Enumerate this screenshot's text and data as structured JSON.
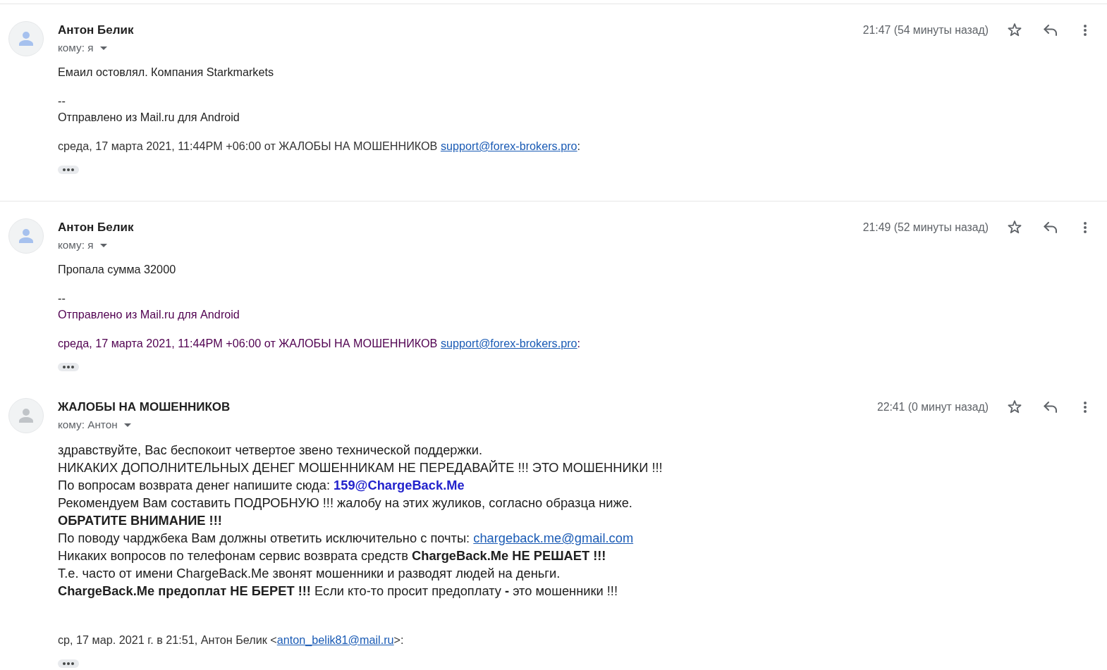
{
  "messages": [
    {
      "sender": "Антон Белик",
      "avatar": {
        "color": "#a6c1ee"
      },
      "recipient": "кому: я",
      "time": "21:47 (54 минуты назад)",
      "starred": false,
      "kind": "plain",
      "body": [
        {
          "lines": [
            {
              "quoted": false,
              "parts": [
                {
                  "kind": "text",
                  "text": "Емаил остовлял. Компания Starkmarkets"
                }
              ]
            }
          ]
        },
        {
          "lines": [
            {
              "quoted": false,
              "parts": [
                {
                  "kind": "text",
                  "text": "--"
                }
              ]
            },
            {
              "quoted": false,
              "parts": [
                {
                  "kind": "text",
                  "text": "Отправлено из Mail.ru для Android"
                }
              ]
            }
          ]
        }
      ],
      "quote_header": {
        "quoted": false,
        "parts": [
          {
            "kind": "text",
            "text": "среда, 17 марта 2021, 11:44PM +06:00 от ЖАЛОБЫ НА МОШЕННИКОВ "
          },
          {
            "kind": "link",
            "text": "support@forex-brokers.pro"
          },
          {
            "kind": "text",
            "text": ":"
          }
        ]
      }
    },
    {
      "sender": "Антон Белик",
      "avatar": {
        "color": "#a6c1ee"
      },
      "recipient": "кому: я",
      "time": "21:49 (52 минуты назад)",
      "starred": false,
      "kind": "plain",
      "body": [
        {
          "lines": [
            {
              "quoted": false,
              "parts": [
                {
                  "kind": "text",
                  "text": "Пропала сумма 32000"
                }
              ]
            }
          ]
        },
        {
          "lines": [
            {
              "quoted": false,
              "parts": [
                {
                  "kind": "text",
                  "text": "--"
                }
              ]
            },
            {
              "quoted": true,
              "parts": [
                {
                  "kind": "text",
                  "text": "Отправлено из Mail.ru для Android"
                }
              ]
            }
          ]
        }
      ],
      "quote_header": {
        "quoted": true,
        "parts": [
          {
            "kind": "text",
            "text": "среда, 17 марта 2021, 11:44PM +06:00 от ЖАЛОБЫ НА МОШЕННИКОВ "
          },
          {
            "kind": "link",
            "text": "support@forex-brokers.pro"
          },
          {
            "kind": "text",
            "text": ":"
          }
        ]
      }
    },
    {
      "sender": "ЖАЛОБЫ НА МОШЕННИКОВ",
      "avatar": {
        "color": "#c0c4c8"
      },
      "recipient": "кому: Антон",
      "time": "22:41 (0 минут назад)",
      "starred": false,
      "kind": "html",
      "body": [
        {
          "lines": [
            {
              "quoted": false,
              "parts": [
                {
                  "kind": "text",
                  "text": "здравствуйте, Вас беспокоит четвертое звено технической поддержки."
                }
              ]
            },
            {
              "quoted": false,
              "parts": [
                {
                  "kind": "text",
                  "text": "НИКАКИХ ДОПОЛНИТЕЛЬНЫХ ДЕНЕГ МОШЕННИКАМ НЕ ПЕРЕДАВАЙТЕ !!! ЭТО МОШЕННИКИ !!!"
                }
              ]
            },
            {
              "quoted": false,
              "parts": [
                {
                  "kind": "text",
                  "text": "По вопросам возврата денег напишите сюда: "
                },
                {
                  "kind": "accent",
                  "text": "159@ChargeBack.Me"
                }
              ]
            },
            {
              "quoted": false,
              "parts": [
                {
                  "kind": "text",
                  "text": "Рекомендуем Вам составить ПОДРОБНУЮ !!! жалобу на этих жуликов, согласно образца ниже."
                }
              ]
            },
            {
              "quoted": false,
              "parts": [
                {
                  "kind": "strong",
                  "text": "ОБРАТИТЕ ВНИМАНИЕ !!!"
                }
              ]
            },
            {
              "quoted": false,
              "parts": [
                {
                  "kind": "text",
                  "text": "По поводу чарджбека Вам должны ответить исключительно с почты: "
                },
                {
                  "kind": "link",
                  "text": "chargeback.me@gmail.com"
                }
              ]
            },
            {
              "quoted": false,
              "parts": [
                {
                  "kind": "text",
                  "text": "Никаких вопросов по телефонам сервис возврата средств "
                },
                {
                  "kind": "strong",
                  "text": "ChargeBack.Me НЕ РЕШАЕТ !!!"
                }
              ]
            },
            {
              "quoted": false,
              "parts": [
                {
                  "kind": "text",
                  "text": "Т.е. часто от имени ChargeBack.Me звонят мошенники и разводят людей на деньги."
                }
              ]
            },
            {
              "quoted": false,
              "parts": [
                {
                  "kind": "strong",
                  "text": "ChargeBack.Me предоплат НЕ БЕРЕТ !!!"
                },
                {
                  "kind": "text",
                  "text": " Если кто-то просит предоплату "
                },
                {
                  "kind": "strong",
                  "text": "-"
                },
                {
                  "kind": "text",
                  "text": " это мошенники !!!"
                }
              ]
            }
          ]
        }
      ],
      "quote_header": {
        "quoted": false,
        "parts": [
          {
            "kind": "text",
            "text": "ср, 17 мар. 2021 г. в 21:51, Антон Белик <"
          },
          {
            "kind": "link",
            "text": "anton_belik81@mail.ru"
          },
          {
            "kind": "text",
            "text": ">:"
          }
        ]
      }
    }
  ]
}
